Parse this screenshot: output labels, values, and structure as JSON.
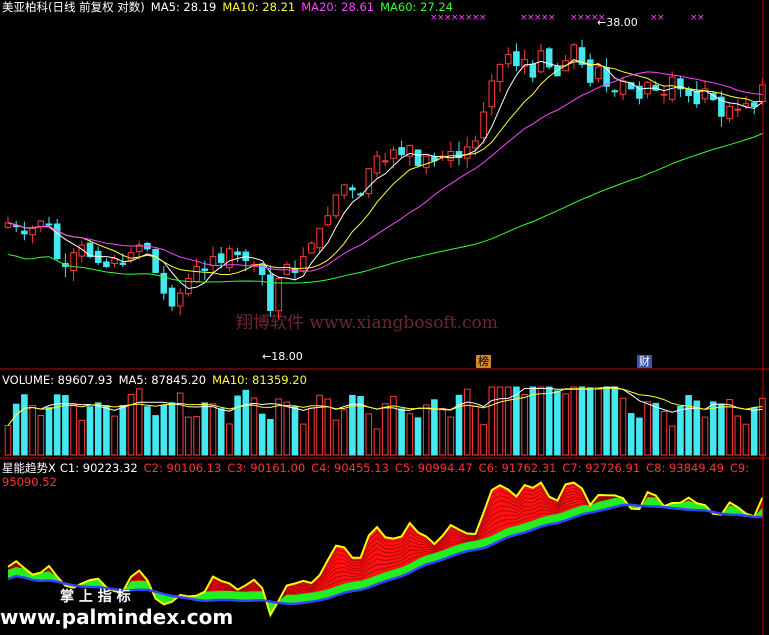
{
  "colors": {
    "background": "#000000",
    "up": "#ff3a3a",
    "down": "#44e8f0",
    "ma5": "#ffffff",
    "ma10": "#ffff33",
    "ma20": "#ff44ff",
    "ma60": "#33ff33",
    "divider": "#cc0000",
    "ribbon_top": "#ffff00",
    "ribbon_red": "#ff1111",
    "ribbon_green": "#22ee22",
    "ribbon_blue": "#3344ff"
  },
  "price_panel": {
    "title": "美亚柏科(日线 前复权 对数)",
    "ma5_label": "MA5: 28.19",
    "ma10_label": "MA10: 28.21",
    "ma20_label": "MA20: 28.61",
    "ma60_label": "MA60: 27.24",
    "high_marker": "38.00",
    "low_marker": "18.00",
    "tag_bang": "榜",
    "tag_cai": "财",
    "watermark": "翔博软件 www.xiangbosoft.com"
  },
  "volume_panel": {
    "volume_label": "VOLUME: 89607.93",
    "ma5_label": "MA5: 87845.20",
    "ma10_label": "MA10: 81359.20"
  },
  "indicator_panel": {
    "name_label": "星能趋势X",
    "c_labels": [
      "C1: 90223.32",
      "C2: 90106.13",
      "C3: 90161.00",
      "C4: 90455.13",
      "C5: 90994.47",
      "C6: 91762.31",
      "C7: 92726.91",
      "C8: 93849.49",
      "C9: 95090.52"
    ],
    "watermark_cn": "掌 上 指 标",
    "watermark_url": "www.palmindex.com"
  },
  "chart_data": {
    "type": "candlestick",
    "price_range": [
      18.0,
      38.0
    ],
    "scale": "log",
    "candle_count": 93,
    "closes": [
      24.2,
      24.0,
      23.6,
      23.9,
      24.3,
      24.1,
      22.3,
      21.9,
      22.6,
      23.0,
      22.4,
      22.1,
      21.9,
      22.3,
      22.0,
      22.6,
      23.0,
      22.8,
      21.6,
      20.6,
      20.0,
      20.6,
      21.3,
      21.9,
      21.7,
      22.4,
      22.1,
      22.8,
      22.5,
      22.2,
      22.0,
      21.5,
      19.8,
      21.3,
      22.0,
      21.6,
      22.4,
      23.1,
      23.9,
      24.6,
      25.8,
      26.4,
      26.1,
      25.8,
      27.4,
      28.2,
      27.9,
      28.6,
      28.3,
      28.9,
      27.6,
      28.2,
      27.9,
      28.2,
      28.5,
      28.1,
      28.8,
      29.2,
      31.2,
      33.5,
      34.8,
      35.6,
      34.7,
      35.2,
      33.8,
      35.9,
      34.6,
      33.9,
      35.1,
      36.4,
      34.8,
      33.4,
      34.6,
      33.1,
      32.7,
      33.5,
      32.9,
      32.2,
      33.4,
      32.8,
      32.5,
      33.8,
      32.9,
      32.4,
      31.8,
      32.9,
      32.1,
      30.9,
      31.6,
      31.4,
      31.8,
      31.6,
      33.2
    ]
  }
}
